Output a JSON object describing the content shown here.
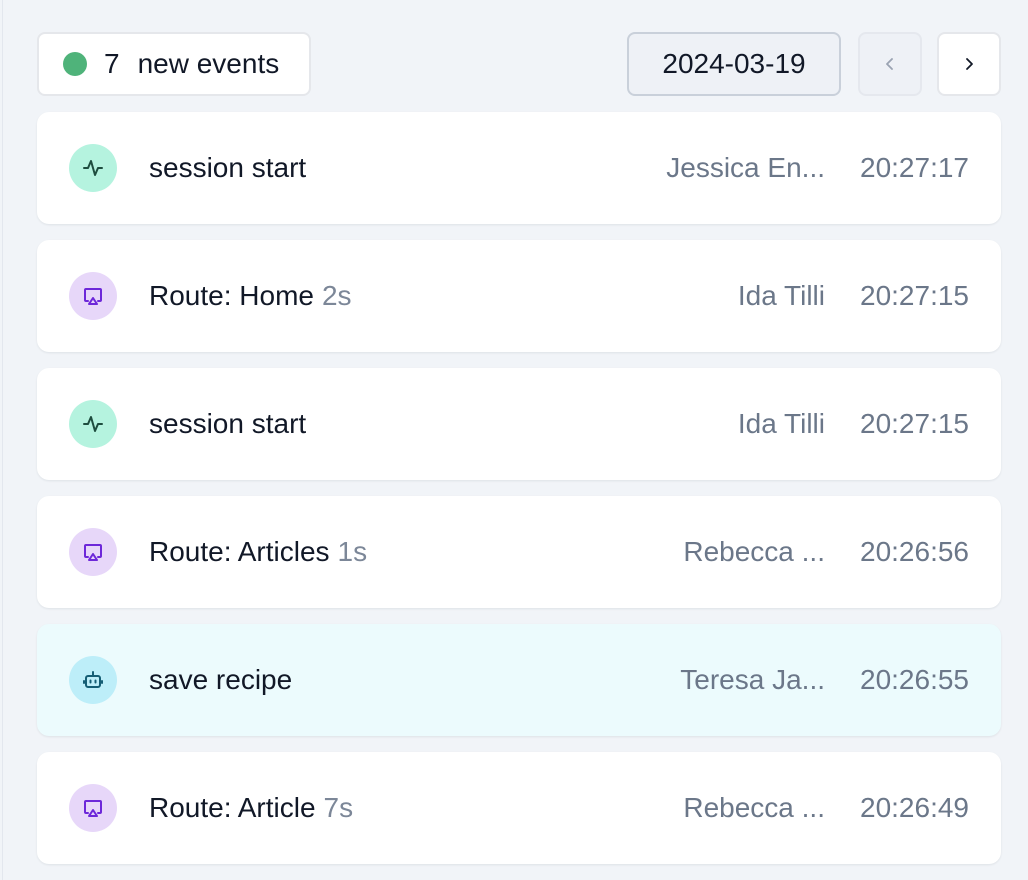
{
  "header": {
    "new_events_count": "7",
    "new_events_label": "new events",
    "date": "2024-03-19",
    "live_color": "#4fb37a",
    "prev_icon": "chevron-left-icon",
    "next_icon": "chevron-right-icon"
  },
  "events": [
    {
      "title": "session start",
      "duration": "",
      "user": "Jessica En...",
      "time": "20:27:17",
      "icon": "activity-icon",
      "color": "#b5f3df"
    },
    {
      "title": "Route: Home",
      "duration": "2s",
      "user": "Ida Tilli",
      "time": "20:27:15",
      "icon": "airplay-icon",
      "color": "#e7d7f9"
    },
    {
      "title": "session start",
      "duration": "",
      "user": "Ida Tilli",
      "time": "20:27:15",
      "icon": "activity-icon",
      "color": "#b5f3df"
    },
    {
      "title": "Route: Articles",
      "duration": "1s",
      "user": "Rebecca ...",
      "time": "20:26:56",
      "icon": "airplay-icon",
      "color": "#e7d7f9"
    },
    {
      "title": "save recipe",
      "duration": "",
      "user": "Teresa Ja...",
      "time": "20:26:55",
      "icon": "bot-icon",
      "color": "#bdeef9",
      "highlighted": true
    },
    {
      "title": "Route: Article",
      "duration": "7s",
      "user": "Rebecca ...",
      "time": "20:26:49",
      "icon": "airplay-icon",
      "color": "#e7d7f9"
    }
  ]
}
